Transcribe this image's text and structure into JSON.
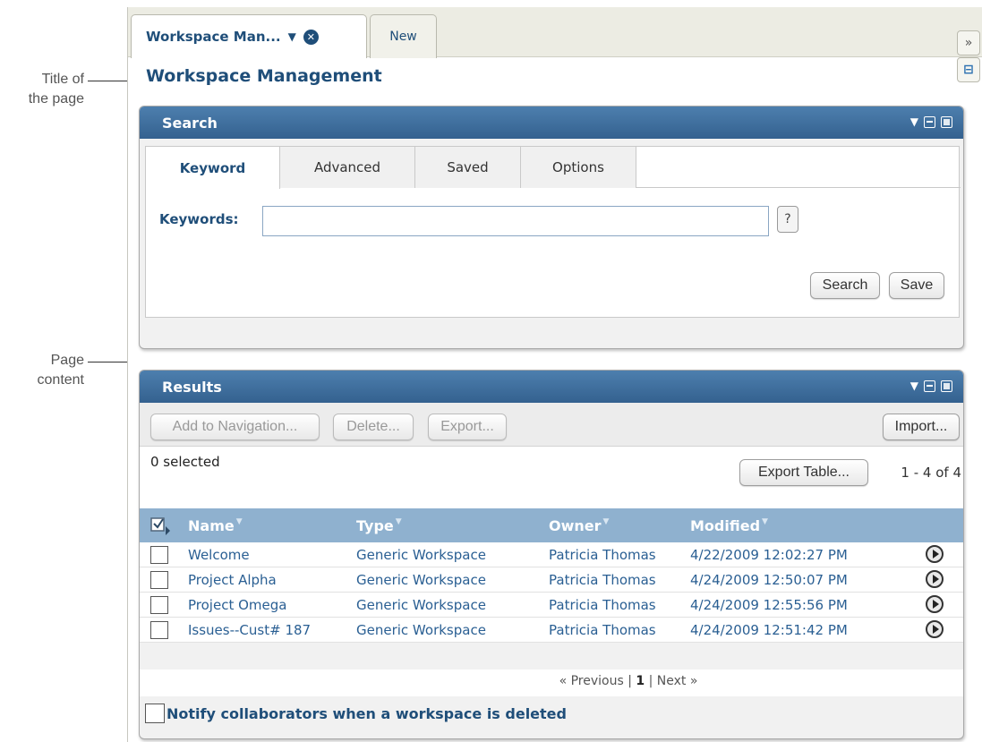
{
  "annotations": {
    "title_label": [
      "Title of",
      "the page"
    ],
    "content_label": [
      "Page",
      "content"
    ]
  },
  "tabs": {
    "active_label": "Workspace Man...",
    "new_label": "New"
  },
  "icons": {
    "collapse": "»",
    "panel_toggle": "⊟"
  },
  "page_title": "Workspace Management",
  "search_panel": {
    "title": "Search",
    "tabs": [
      "Keyword",
      "Advanced",
      "Saved",
      "Options"
    ],
    "keywords_label": "Keywords:",
    "keywords_value": "",
    "help_label": "?",
    "search_button": "Search",
    "save_button": "Save"
  },
  "results_panel": {
    "title": "Results",
    "toolbar": {
      "add_nav": "Add to Navigation...",
      "delete": "Delete...",
      "export": "Export...",
      "import": "Import..."
    },
    "selected_count": "0 selected",
    "export_table": "Export Table...",
    "range": "1 - 4 of 4",
    "columns": [
      "Name",
      "Type",
      "Owner",
      "Modified"
    ],
    "rows": [
      {
        "name": "Welcome",
        "type": "Generic Workspace",
        "owner": "Patricia Thomas",
        "modified": "4/22/2009 12:02:27 PM"
      },
      {
        "name": "Project Alpha",
        "type": "Generic Workspace",
        "owner": "Patricia Thomas",
        "modified": "4/24/2009 12:50:07 PM"
      },
      {
        "name": "Project Omega",
        "type": "Generic Workspace",
        "owner": "Patricia Thomas",
        "modified": "4/24/2009 12:55:56 PM"
      },
      {
        "name": "Issues--Cust# 187",
        "type": "Generic Workspace",
        "owner": "Patricia Thomas",
        "modified": "4/24/2009 12:51:42 PM"
      }
    ],
    "pager": {
      "previous": "« Previous",
      "current": "1",
      "next": "Next »"
    },
    "notify_label": "Notify collaborators when a workspace is deleted"
  },
  "colors": {
    "header_blue": "#3e6d9b",
    "title_blue": "#1f4e79",
    "table_header": "#8fb1cf"
  }
}
